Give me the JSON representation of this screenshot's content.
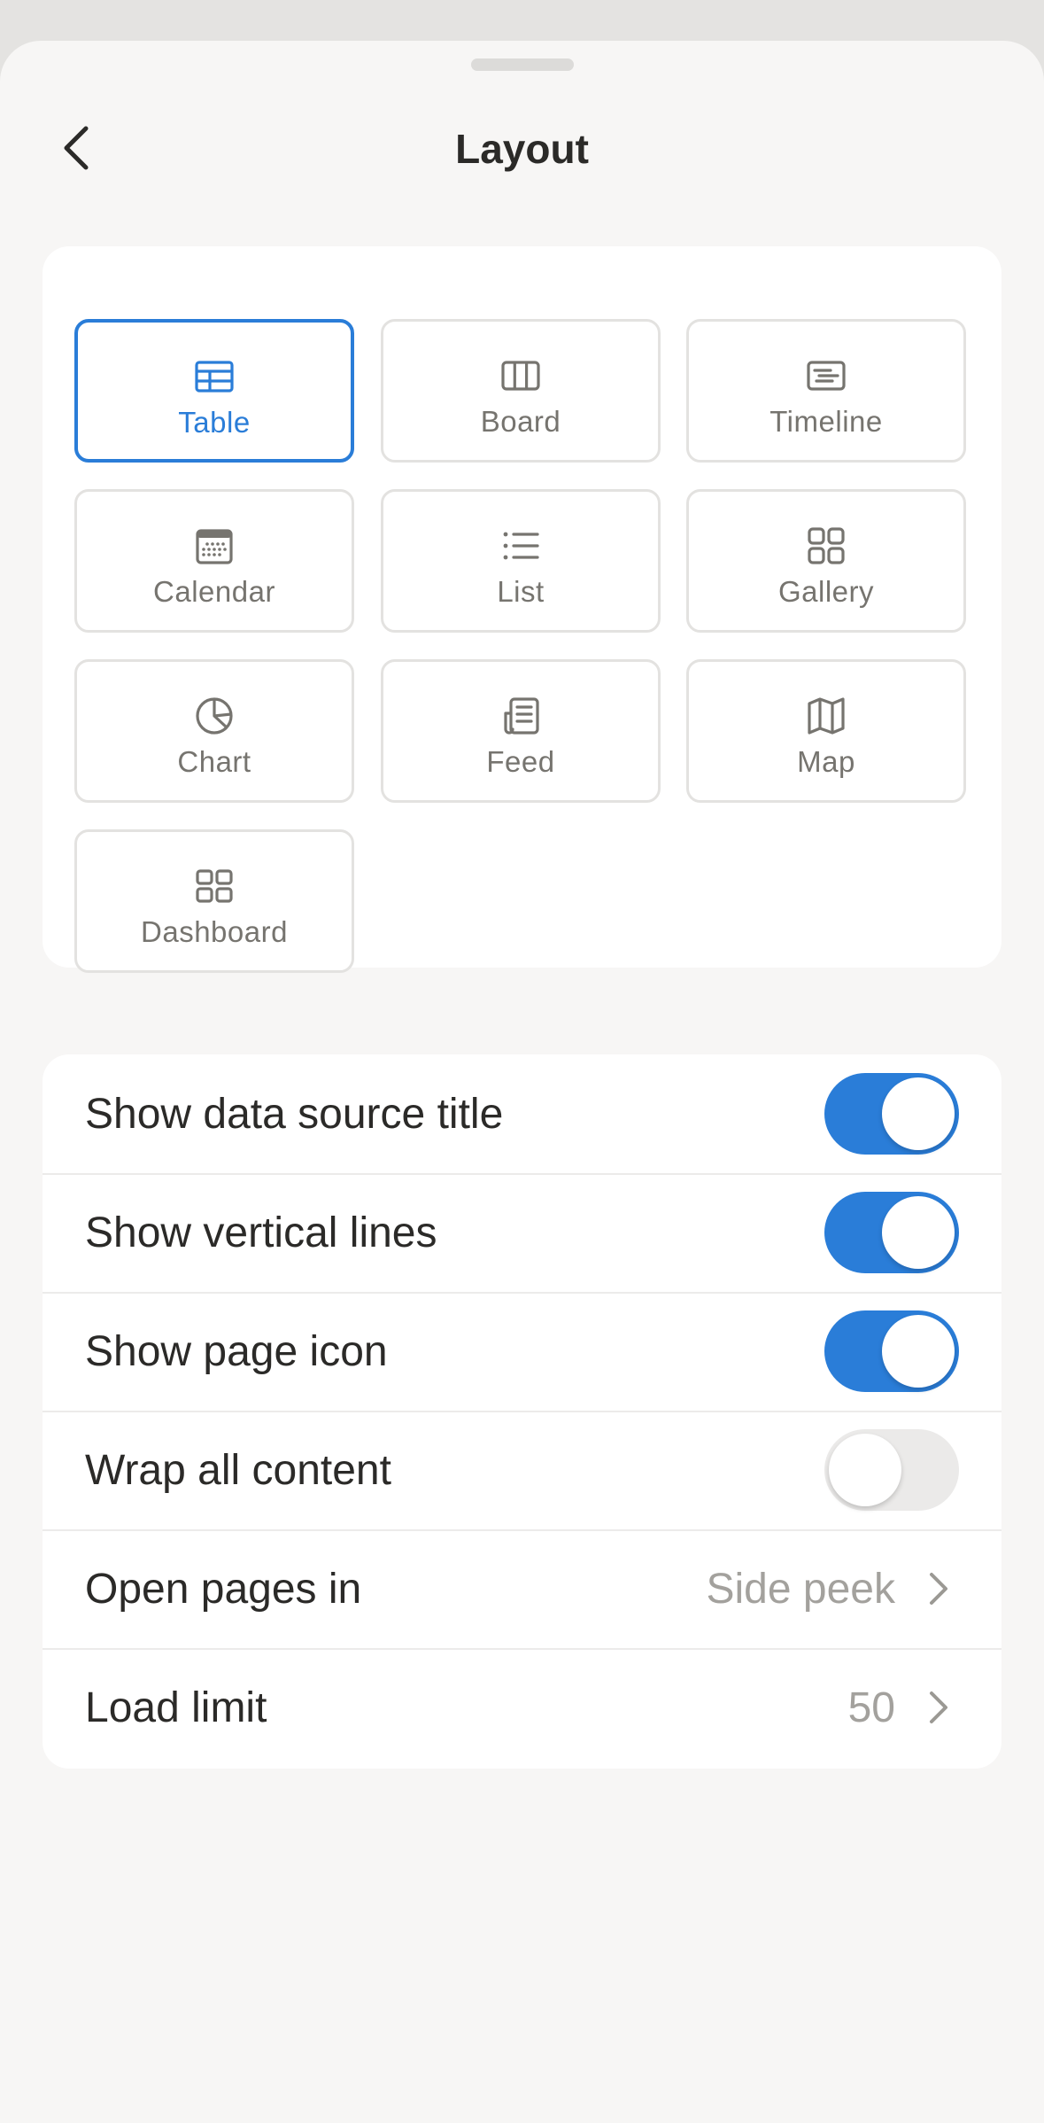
{
  "header": {
    "title": "Layout"
  },
  "layouts": [
    {
      "label": "Table",
      "icon": "table-icon",
      "selected": true
    },
    {
      "label": "Board",
      "icon": "board-icon",
      "selected": false
    },
    {
      "label": "Timeline",
      "icon": "timeline-icon",
      "selected": false
    },
    {
      "label": "Calendar",
      "icon": "calendar-icon",
      "selected": false
    },
    {
      "label": "List",
      "icon": "list-icon",
      "selected": false
    },
    {
      "label": "Gallery",
      "icon": "gallery-icon",
      "selected": false
    },
    {
      "label": "Chart",
      "icon": "chart-icon",
      "selected": false
    },
    {
      "label": "Feed",
      "icon": "feed-icon",
      "selected": false
    },
    {
      "label": "Map",
      "icon": "map-icon",
      "selected": false
    },
    {
      "label": "Dashboard",
      "icon": "dashboard-icon",
      "selected": false
    }
  ],
  "settings": [
    {
      "label": "Show data source title",
      "type": "toggle",
      "on": true
    },
    {
      "label": "Show vertical lines",
      "type": "toggle",
      "on": true
    },
    {
      "label": "Show page icon",
      "type": "toggle",
      "on": true
    },
    {
      "label": "Wrap all content",
      "type": "toggle",
      "on": false
    },
    {
      "label": "Open pages in",
      "type": "value",
      "value": "Side peek"
    },
    {
      "label": "Load limit",
      "type": "value",
      "value": "50"
    }
  ],
  "colors": {
    "accent": "#2a7dd8",
    "icon_gray": "#76746f"
  }
}
